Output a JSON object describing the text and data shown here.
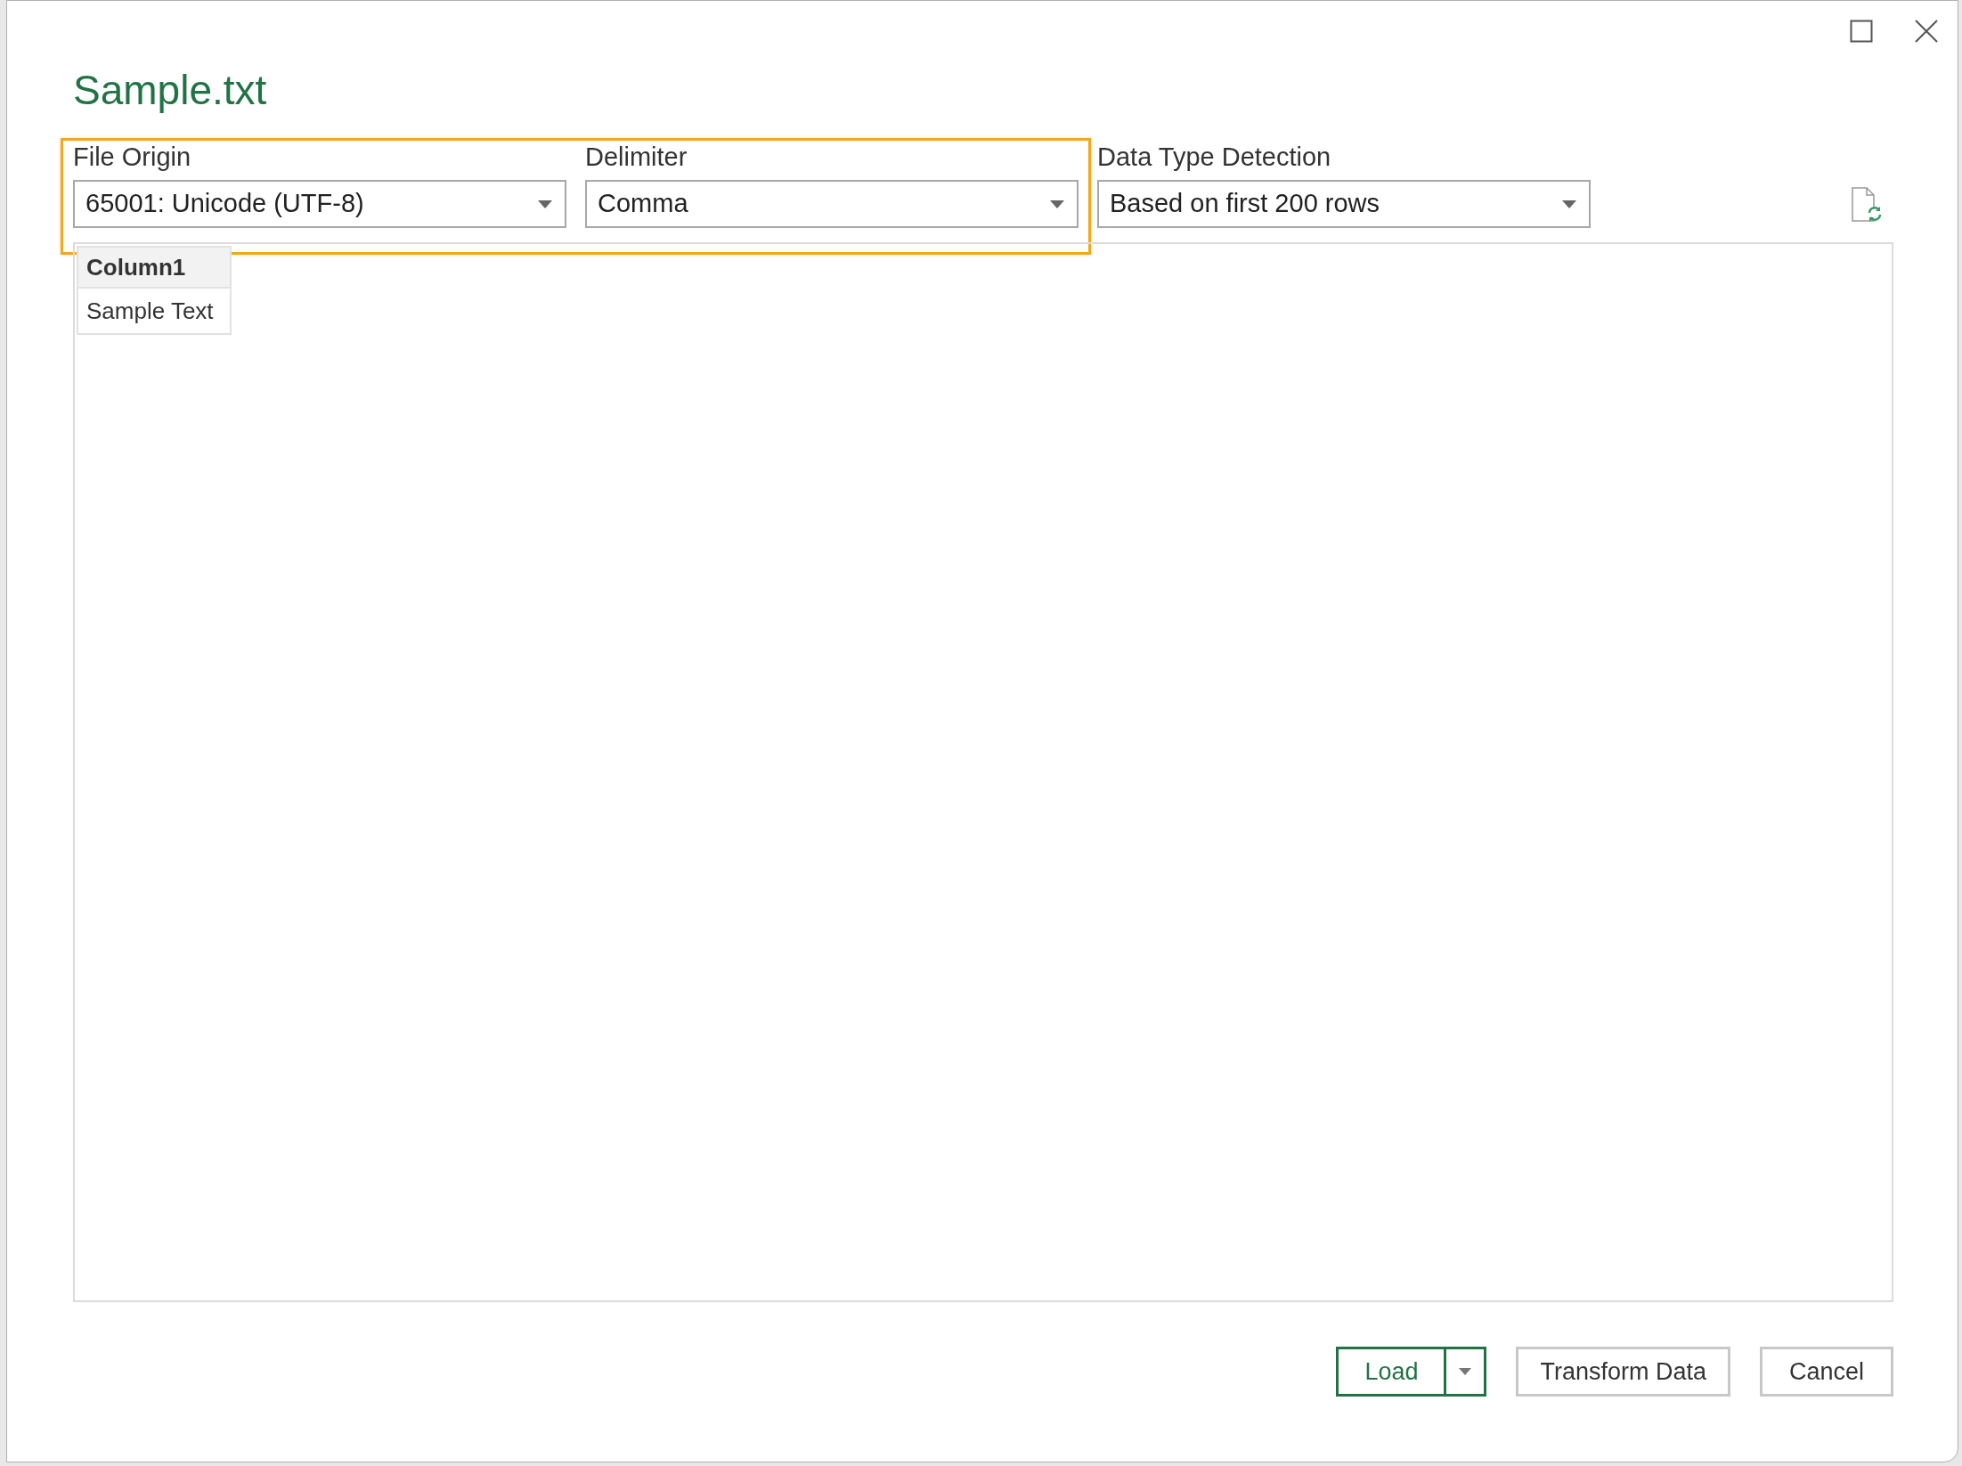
{
  "window": {
    "title": "Sample.txt"
  },
  "options": [
    {
      "label": "File Origin",
      "value": "65001: Unicode (UTF-8)",
      "highlighted": true
    },
    {
      "label": "Delimiter",
      "value": "Comma",
      "highlighted": true
    },
    {
      "label": "Data Type Detection",
      "value": "Based on first 200 rows",
      "highlighted": false
    }
  ],
  "table": {
    "columns": [
      "Column1"
    ],
    "rows": [
      [
        "Sample Text"
      ]
    ]
  },
  "buttons": [
    {
      "label": "Load",
      "kind": "split"
    },
    {
      "label": "Transform Data",
      "kind": "plain"
    },
    {
      "label": "Cancel",
      "kind": "plain"
    }
  ]
}
